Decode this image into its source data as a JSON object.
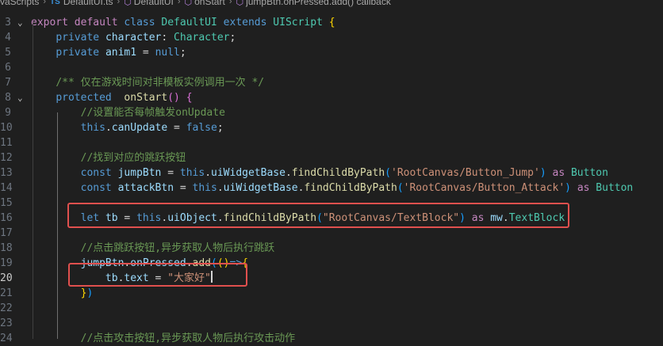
{
  "breadcrumb": {
    "folder": "vaScripts",
    "ts_badge": "TS",
    "file": "DefaultUI.ts",
    "class": "DefaultUI",
    "method": "onStart",
    "callback": "jumpBtn.onPressed.add() callback"
  },
  "editor": {
    "active_line": "20",
    "lines": [
      {
        "num": "",
        "tokens": []
      },
      {
        "num": "3",
        "tokens": [
          [
            "ctl",
            "export"
          ],
          [
            "txt",
            " "
          ],
          [
            "ctl",
            "default"
          ],
          [
            "txt",
            " "
          ],
          [
            "kw",
            "class"
          ],
          [
            "txt",
            " "
          ],
          [
            "cls",
            "DefaultUI"
          ],
          [
            "txt",
            " "
          ],
          [
            "kw",
            "extends"
          ],
          [
            "txt",
            " "
          ],
          [
            "cls",
            "UIScript"
          ],
          [
            "txt",
            " "
          ],
          [
            "br1",
            "{"
          ]
        ]
      },
      {
        "num": "4",
        "tokens": [
          [
            "txt",
            "    "
          ],
          [
            "kw",
            "private"
          ],
          [
            "txt",
            " "
          ],
          [
            "var",
            "character"
          ],
          [
            "txt",
            ": "
          ],
          [
            "cls",
            "Character"
          ],
          [
            "txt",
            ";"
          ]
        ]
      },
      {
        "num": "5",
        "tokens": [
          [
            "txt",
            "    "
          ],
          [
            "kw",
            "private"
          ],
          [
            "txt",
            " "
          ],
          [
            "var",
            "anim1"
          ],
          [
            "txt",
            " = "
          ],
          [
            "kw",
            "null"
          ],
          [
            "txt",
            ";"
          ]
        ]
      },
      {
        "num": "6",
        "tokens": []
      },
      {
        "num": "7",
        "tokens": [
          [
            "txt",
            "    "
          ],
          [
            "cmt",
            "/** 仅在游戏时间对非模板实例调用一次 */"
          ]
        ]
      },
      {
        "num": "8",
        "tokens": [
          [
            "txt",
            "    "
          ],
          [
            "kw",
            "protected"
          ],
          [
            "txt",
            "  "
          ],
          [
            "fn",
            "onStart"
          ],
          [
            "br2",
            "()"
          ],
          [
            "txt",
            " "
          ],
          [
            "br2",
            "{"
          ]
        ]
      },
      {
        "num": "9",
        "tokens": [
          [
            "txt",
            "        "
          ],
          [
            "cmt",
            "//设置能否每帧触发onUpdate"
          ]
        ]
      },
      {
        "num": "10",
        "tokens": [
          [
            "txt",
            "        "
          ],
          [
            "kw",
            "this"
          ],
          [
            "txt",
            "."
          ],
          [
            "var",
            "canUpdate"
          ],
          [
            "txt",
            " = "
          ],
          [
            "kw",
            "false"
          ],
          [
            "txt",
            ";"
          ]
        ]
      },
      {
        "num": "11",
        "tokens": []
      },
      {
        "num": "12",
        "tokens": [
          [
            "txt",
            "        "
          ],
          [
            "cmt",
            "//找到对应的跳跃按钮"
          ]
        ]
      },
      {
        "num": "13",
        "tokens": [
          [
            "txt",
            "        "
          ],
          [
            "kw",
            "const"
          ],
          [
            "txt",
            " "
          ],
          [
            "var",
            "jumpBtn"
          ],
          [
            "txt",
            " = "
          ],
          [
            "kw",
            "this"
          ],
          [
            "txt",
            "."
          ],
          [
            "var",
            "uiWidgetBase"
          ],
          [
            "txt",
            "."
          ],
          [
            "fn",
            "findChildByPath"
          ],
          [
            "br3",
            "("
          ],
          [
            "str",
            "'RootCanvas/Button_Jump'"
          ],
          [
            "br3",
            ")"
          ],
          [
            "txt",
            " "
          ],
          [
            "ctl",
            "as"
          ],
          [
            "txt",
            " "
          ],
          [
            "cls",
            "Button"
          ]
        ]
      },
      {
        "num": "14",
        "tokens": [
          [
            "txt",
            "        "
          ],
          [
            "kw",
            "const"
          ],
          [
            "txt",
            " "
          ],
          [
            "var",
            "attackBtn"
          ],
          [
            "txt",
            " = "
          ],
          [
            "kw",
            "this"
          ],
          [
            "txt",
            "."
          ],
          [
            "var",
            "uiWidgetBase"
          ],
          [
            "txt",
            "."
          ],
          [
            "fn",
            "findChildByPath"
          ],
          [
            "br3",
            "("
          ],
          [
            "str",
            "'RootCanvas/Button_Attack'"
          ],
          [
            "br3",
            ")"
          ],
          [
            "txt",
            " "
          ],
          [
            "ctl",
            "as"
          ],
          [
            "txt",
            " "
          ],
          [
            "cls",
            "Button"
          ]
        ]
      },
      {
        "num": "15",
        "tokens": []
      },
      {
        "num": "16",
        "tokens": [
          [
            "txt",
            "        "
          ],
          [
            "kw",
            "let"
          ],
          [
            "txt",
            " "
          ],
          [
            "var",
            "tb"
          ],
          [
            "txt",
            " = "
          ],
          [
            "kw",
            "this"
          ],
          [
            "txt",
            "."
          ],
          [
            "var",
            "uiObject"
          ],
          [
            "txt",
            "."
          ],
          [
            "fn",
            "findChildByPath"
          ],
          [
            "br3",
            "("
          ],
          [
            "str",
            "\"RootCanvas/TextBlock\""
          ],
          [
            "br3",
            ")"
          ],
          [
            "txt",
            " "
          ],
          [
            "ctl",
            "as"
          ],
          [
            "txt",
            " "
          ],
          [
            "var",
            "mw"
          ],
          [
            "txt",
            "."
          ],
          [
            "cls",
            "TextBlock"
          ]
        ]
      },
      {
        "num": "17",
        "tokens": []
      },
      {
        "num": "18",
        "tokens": [
          [
            "txt",
            "        "
          ],
          [
            "cmt",
            "//点击跳跃按钮,异步获取人物后执行跳跃"
          ]
        ]
      },
      {
        "num": "19",
        "tokens": [
          [
            "txt",
            "        "
          ],
          [
            "var",
            "jumpBtn"
          ],
          [
            "txt",
            "."
          ],
          [
            "var",
            "onPressed"
          ],
          [
            "txt",
            "."
          ],
          [
            "fn",
            "add"
          ],
          [
            "br3",
            "("
          ],
          [
            "br1",
            "()"
          ],
          [
            "kw",
            "=>"
          ],
          [
            "br1",
            "{"
          ]
        ]
      },
      {
        "num": "20",
        "tokens": [
          [
            "txt",
            "            "
          ],
          [
            "var",
            "tb"
          ],
          [
            "txt",
            "."
          ],
          [
            "var",
            "text"
          ],
          [
            "txt",
            " = "
          ],
          [
            "str",
            "\"大家好\""
          ],
          [
            "cursor",
            ""
          ]
        ]
      },
      {
        "num": "21",
        "tokens": [
          [
            "txt",
            "        "
          ],
          [
            "br1",
            "}"
          ],
          [
            "br3",
            ")"
          ]
        ]
      },
      {
        "num": "22",
        "tokens": []
      },
      {
        "num": "23",
        "tokens": []
      },
      {
        "num": "24",
        "tokens": [
          [
            "txt",
            "        "
          ],
          [
            "cmt",
            "//点击攻击按钮,异步获取人物后执行攻击动作"
          ]
        ]
      }
    ],
    "folds": [
      "3",
      "8"
    ]
  },
  "colors": {
    "background": "#1f1f1f",
    "highlight_box": "#e0504e"
  }
}
